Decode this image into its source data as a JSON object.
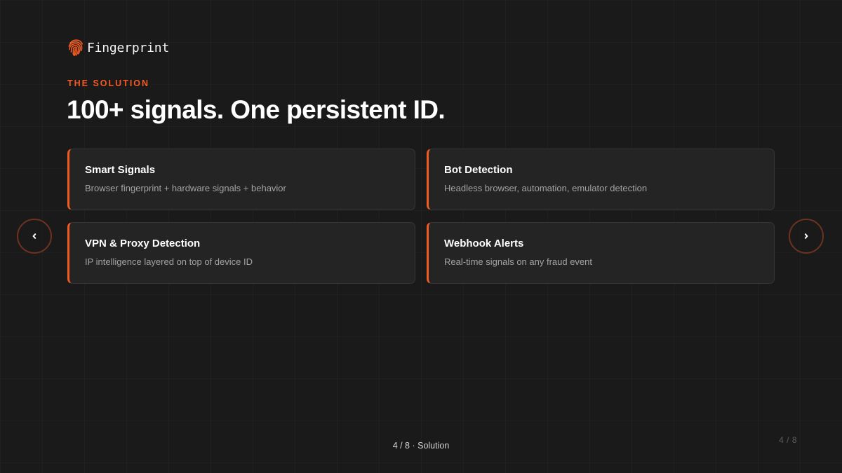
{
  "brand": {
    "name": "Fingerprint",
    "icon": "fingerprint-icon",
    "accent_color": "#f35b22"
  },
  "slide": {
    "eyebrow": "THE SOLUTION",
    "headline": "100+ signals. One persistent ID.",
    "cards": [
      {
        "title": "Smart Signals",
        "description": "Browser fingerprint + hardware signals + behavior"
      },
      {
        "title": "Bot Detection",
        "description": "Headless browser, automation, emulator detection"
      },
      {
        "title": "VPN & Proxy Detection",
        "description": "IP intelligence layered on top of device ID"
      },
      {
        "title": "Webhook Alerts",
        "description": "Real-time signals on any fraud event"
      }
    ]
  },
  "navigation": {
    "prev_icon": "chevron-left-icon",
    "next_icon": "chevron-right-icon",
    "position_label": "4 / 8 · Solution",
    "page_counter": "4 / 8"
  },
  "colors": {
    "background": "#1a1a1a",
    "card_background": "#242424",
    "card_border": "#363636",
    "nav_border": "#6b3320"
  }
}
